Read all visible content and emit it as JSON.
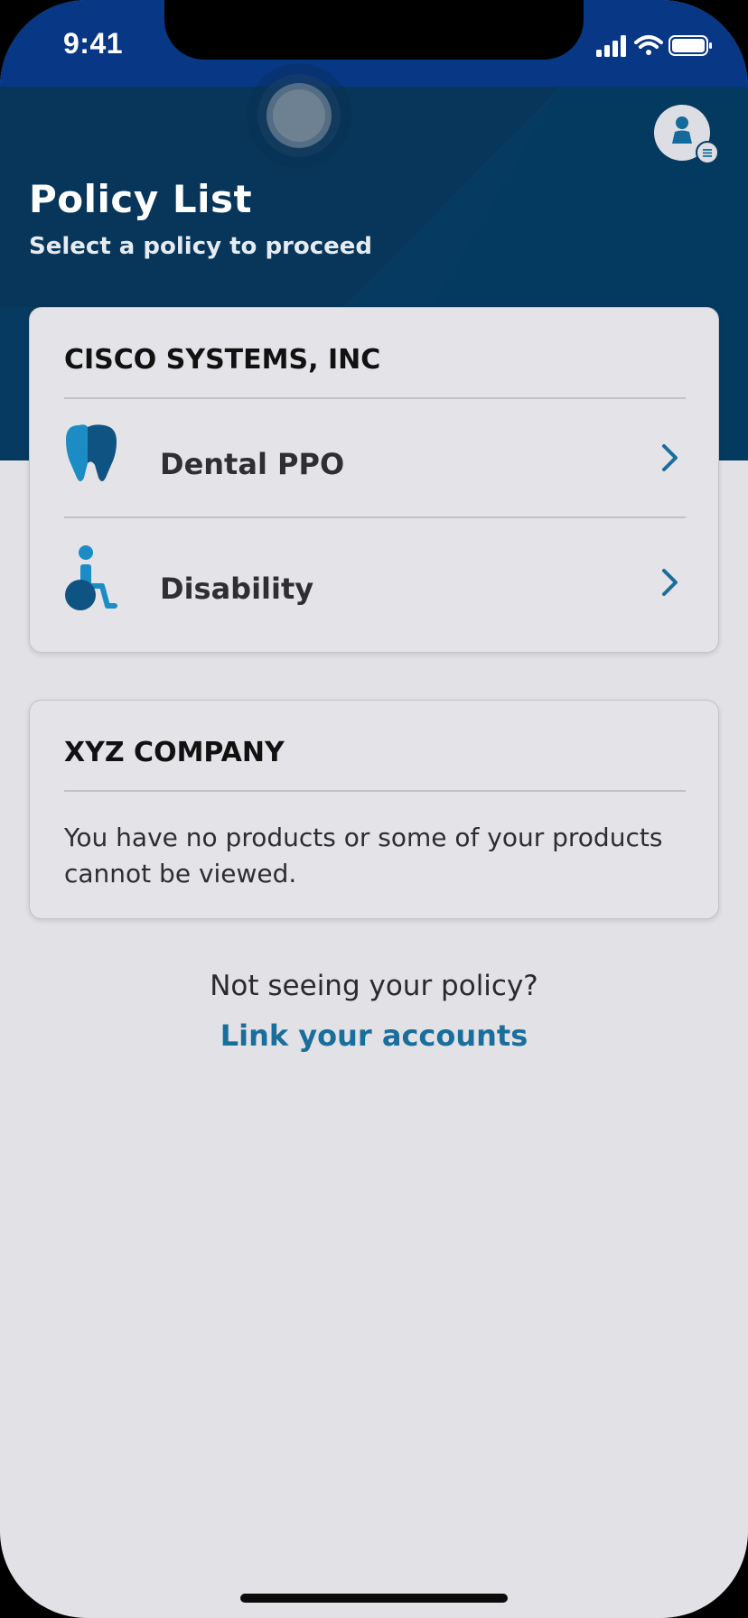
{
  "status_bar": {
    "time": "9:41"
  },
  "header": {
    "title": "Policy List",
    "subtitle": "Select a policy to proceed",
    "avatar_icon": "user-account-icon"
  },
  "employers": [
    {
      "name": "CISCO SYSTEMS, INC",
      "policies": [
        {
          "label": "Dental PPO",
          "icon": "tooth-icon"
        },
        {
          "label": "Disability",
          "icon": "wheelchair-icon"
        }
      ]
    },
    {
      "name": "XYZ COMPANY",
      "message": "You have no products or some of your products cannot be viewed."
    }
  ],
  "footer": {
    "prompt": "Not seeing your policy?",
    "link": "Link your accounts"
  },
  "colors": {
    "header_bg": "#063a60",
    "status_band": "#083786",
    "accent": "#1a6e9c",
    "icon_light": "#1b8cc4",
    "icon_dark": "#0f5382",
    "page_bg": "#e2e1e5"
  }
}
